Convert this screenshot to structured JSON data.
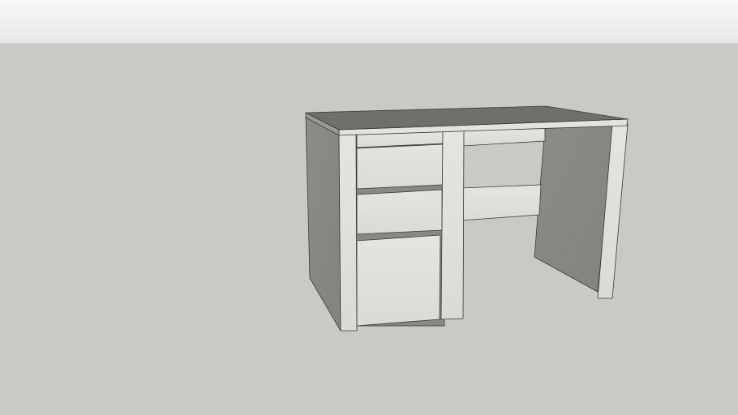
{
  "scene": {
    "model": "desk",
    "colors": {
      "sky": "#eceeee",
      "ground": "#c9cac6",
      "wood_light": "#e2e0da",
      "wood_shadow": "#8c8a86",
      "top_surface": "#716f6b",
      "edge": "#3a3836"
    }
  }
}
